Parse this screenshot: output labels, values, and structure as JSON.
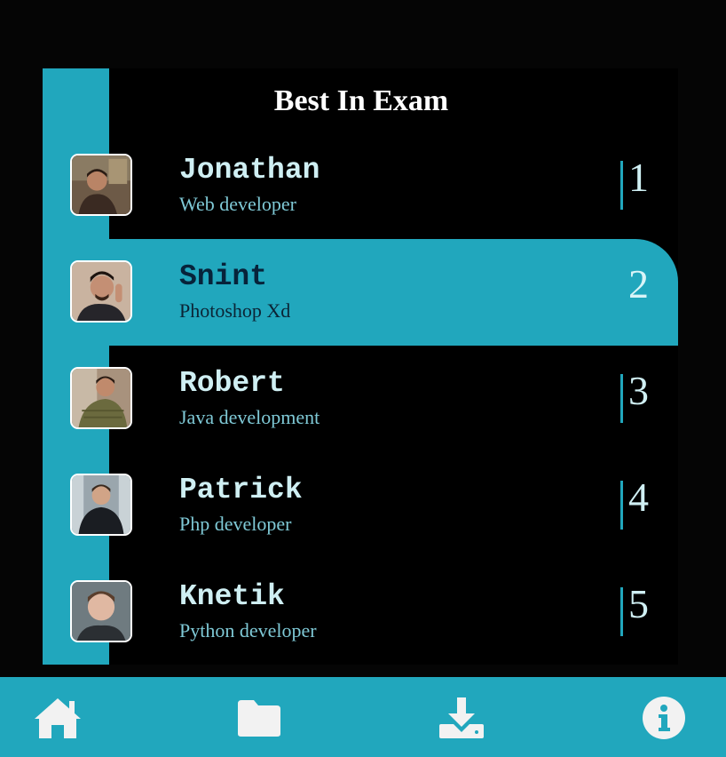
{
  "card": {
    "title": "Best In Exam"
  },
  "leaderboard": [
    {
      "name": "Jonathan",
      "role": "Web developer",
      "rank": "1",
      "active": false,
      "avatar": "avatar-photo"
    },
    {
      "name": "Snint",
      "role": "Photoshop Xd",
      "rank": "2",
      "active": true,
      "avatar": "avatar-photo"
    },
    {
      "name": "Robert",
      "role": "Java development",
      "rank": "3",
      "active": false,
      "avatar": "avatar-photo"
    },
    {
      "name": "Patrick",
      "role": "Php developer",
      "rank": "4",
      "active": false,
      "avatar": "avatar-photo"
    },
    {
      "name": "Knetik",
      "role": "Python developer",
      "rank": "5",
      "active": false,
      "avatar": "avatar-photo"
    }
  ],
  "navbar": {
    "items": [
      {
        "icon": "home-icon"
      },
      {
        "icon": "folder-icon"
      },
      {
        "icon": "download-icon"
      },
      {
        "icon": "info-icon"
      }
    ]
  },
  "colors": {
    "accent": "#21a7bd",
    "background": "#000000",
    "name_text": "#cfeff3",
    "role_text": "#7fc9d6",
    "active_text": "#07233a"
  }
}
